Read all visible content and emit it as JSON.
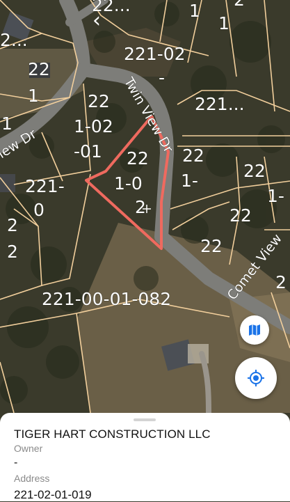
{
  "map": {
    "road_labels": {
      "twin_view": "Twin View Dr",
      "view_dr": "iew Dr",
      "comet_view": "Comet View"
    },
    "parcel_labels": {
      "p_top_edge": "22...",
      "p_top_left": "2...",
      "p_top_right_a": "1",
      "p_top_right_b": "2",
      "p_top_right_c": "1",
      "p_221_02_a": "221-02",
      "p_221_02_b": "-",
      "p_221_right": "221...",
      "p_left_a": "22",
      "p_left_b": "1",
      "p_left_edge_1": "1",
      "p_mid_a": "22",
      "p_mid_b": "1-02",
      "p_mid_c": "-01",
      "p_sel_a": "22",
      "p_sel_b": "1-0",
      "p_sel_c": "2",
      "p_right_a": "22",
      "p_right_b": "1-",
      "p_far_a": "22",
      "p_far_b": "1-",
      "p_221_0_a": "221-",
      "p_221_0_b": "0",
      "p_right_22_1": "22",
      "p_right_22_2": "22",
      "p_left_22_a": "2",
      "p_left_22_b": "2",
      "p_edge_2": "2",
      "p_big": "221-00-01-082"
    },
    "boundary_color": "#f2cf9c",
    "road_color": "#7d7d79",
    "highlight_color": "#ef6a5f"
  },
  "controls": {
    "back_icon": "chevron-left-icon",
    "layers_icon": "map-icon",
    "location_icon": "my-location-icon",
    "accent": "#1a73e8"
  },
  "sheet": {
    "owner_name": "TIGER HART CONSTRUCTION LLC",
    "owner_caption": "Owner",
    "address_value": "-",
    "address_caption": "Address",
    "parcel_id": "221-02-01-019"
  }
}
